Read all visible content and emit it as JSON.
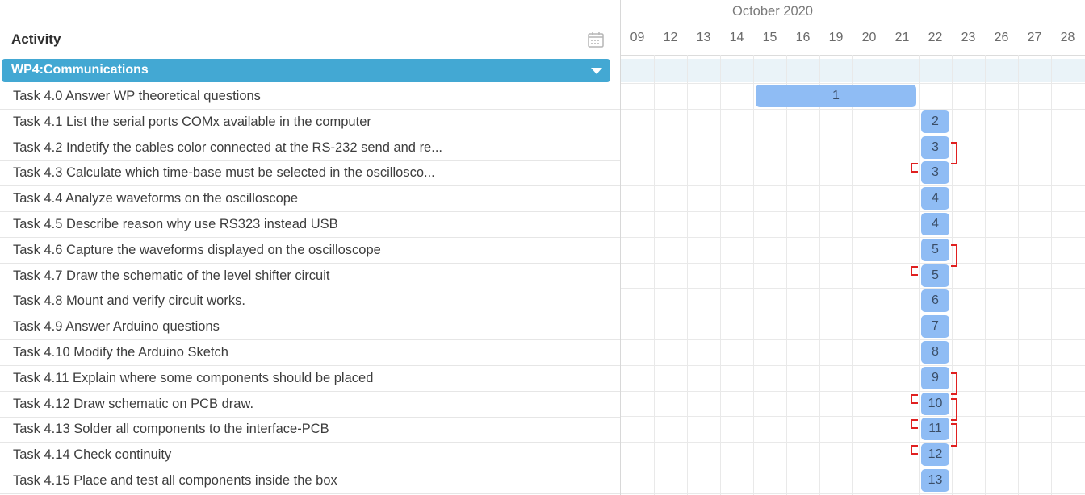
{
  "sidebar": {
    "header": "Activity",
    "calendar_icon": "calendar-icon",
    "group": {
      "label": "WP4:Communications",
      "icon": "chevron-down-icon",
      "color": "#43a8d3"
    },
    "tasks": [
      "Task 4.0 Answer WP theoretical questions",
      "Task 4.1 List the serial ports COMx available in the computer",
      "Task 4.2 Indetify the cables color connected at the RS-232 send and re...",
      "Task 4.3 Calculate which time-base must be selected in the oscillosco...",
      "Task 4.4 Analyze waveforms on the oscilloscope",
      "Task 4.5 Describe reason why use RS323 instead USB",
      "Task 4.6 Capture the waveforms displayed on the oscilloscope",
      "Task 4.7 Draw the schematic of the level shifter circuit",
      "Task 4.8 Mount and verify circuit works.",
      "Task 4.9 Answer Arduino questions",
      "Task 4.10 Modify the Arduino Sketch",
      "Task 4.11 Explain where some components should be placed",
      "Task 4.12 Draw schematic on PCB draw.",
      "Task 4.13 Solder all components to the interface-PCB",
      "Task 4.14 Check continuity",
      "Task 4.15 Place and test all components inside the box"
    ]
  },
  "timeline": {
    "month": "October 2020",
    "days": [
      "09",
      "12",
      "13",
      "14",
      "15",
      "16",
      "19",
      "20",
      "21",
      "22",
      "23",
      "26",
      "27",
      "28"
    ],
    "bar_color": "#8fbcf4",
    "dependency_color": "#e02020",
    "bars": [
      {
        "start": "15",
        "end": "21",
        "label": "1"
      },
      {
        "start": "22",
        "end": "22",
        "label": "2"
      },
      {
        "start": "22",
        "end": "22",
        "label": "3"
      },
      {
        "start": "22",
        "end": "22",
        "label": "3"
      },
      {
        "start": "22",
        "end": "22",
        "label": "4"
      },
      {
        "start": "22",
        "end": "22",
        "label": "4"
      },
      {
        "start": "22",
        "end": "22",
        "label": "5"
      },
      {
        "start": "22",
        "end": "22",
        "label": "5"
      },
      {
        "start": "22",
        "end": "22",
        "label": "6"
      },
      {
        "start": "22",
        "end": "22",
        "label": "7"
      },
      {
        "start": "22",
        "end": "22",
        "label": "8"
      },
      {
        "start": "22",
        "end": "22",
        "label": "9"
      },
      {
        "start": "22",
        "end": "22",
        "label": "10"
      },
      {
        "start": "22",
        "end": "22",
        "label": "11"
      },
      {
        "start": "22",
        "end": "22",
        "label": "12"
      },
      {
        "start": "22",
        "end": "22",
        "label": "13"
      }
    ],
    "dependencies": [
      {
        "from_task": 3,
        "to_task": 4
      },
      {
        "from_task": 7,
        "to_task": 8
      },
      {
        "from_task": 12,
        "to_task": 13
      },
      {
        "from_task": 13,
        "to_task": 14
      },
      {
        "from_task": 14,
        "to_task": 15
      }
    ]
  }
}
